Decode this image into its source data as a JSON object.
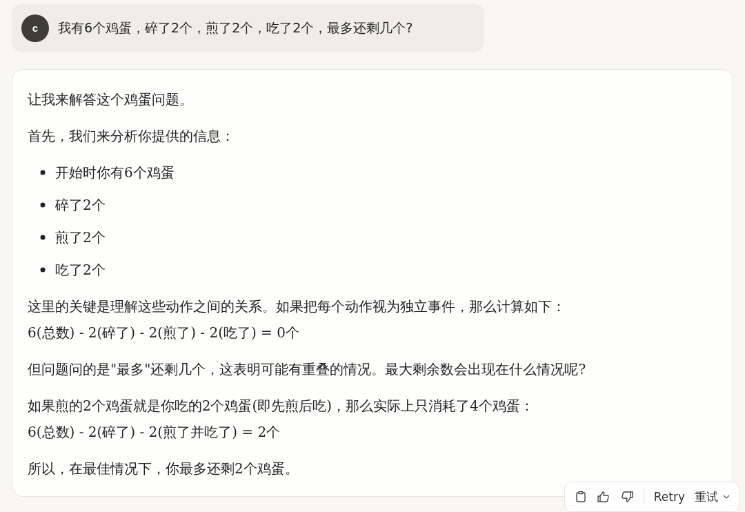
{
  "user_message": {
    "avatar": "c",
    "text": "我有6个鸡蛋，碎了2个，煎了2个，吃了2个，最多还剩几个?"
  },
  "response": {
    "blocks": [
      {
        "kind": "paragraph",
        "lines": [
          "让我来解答这个鸡蛋问题。"
        ]
      },
      {
        "kind": "paragraph",
        "lines": [
          "首先，我们来分析你提供的信息："
        ]
      },
      {
        "kind": "list",
        "items": [
          "开始时你有6个鸡蛋",
          "碎了2个",
          "煎了2个",
          "吃了2个"
        ]
      },
      {
        "kind": "paragraph",
        "lines": [
          "这里的关键是理解这些动作之间的关系。如果把每个动作视为独立事件，那么计算如下：",
          "6(总数) - 2(碎了) - 2(煎了) - 2(吃了) = 0个"
        ]
      },
      {
        "kind": "paragraph",
        "lines": [
          "但问题问的是\"最多\"还剩几个，这表明可能有重叠的情况。最大剩余数会出现在什么情况呢?"
        ]
      },
      {
        "kind": "paragraph",
        "lines": [
          "如果煎的2个鸡蛋就是你吃的2个鸡蛋(即先煎后吃)，那么实际上只消耗了4个鸡蛋：",
          "6(总数) - 2(碎了) - 2(煎了并吃了) = 2个"
        ]
      },
      {
        "kind": "paragraph",
        "lines": [
          "所以，在最佳情况下，你最多还剩2个鸡蛋。"
        ]
      }
    ]
  },
  "actions": {
    "retry": "Retry",
    "retry_zh": "重试"
  }
}
